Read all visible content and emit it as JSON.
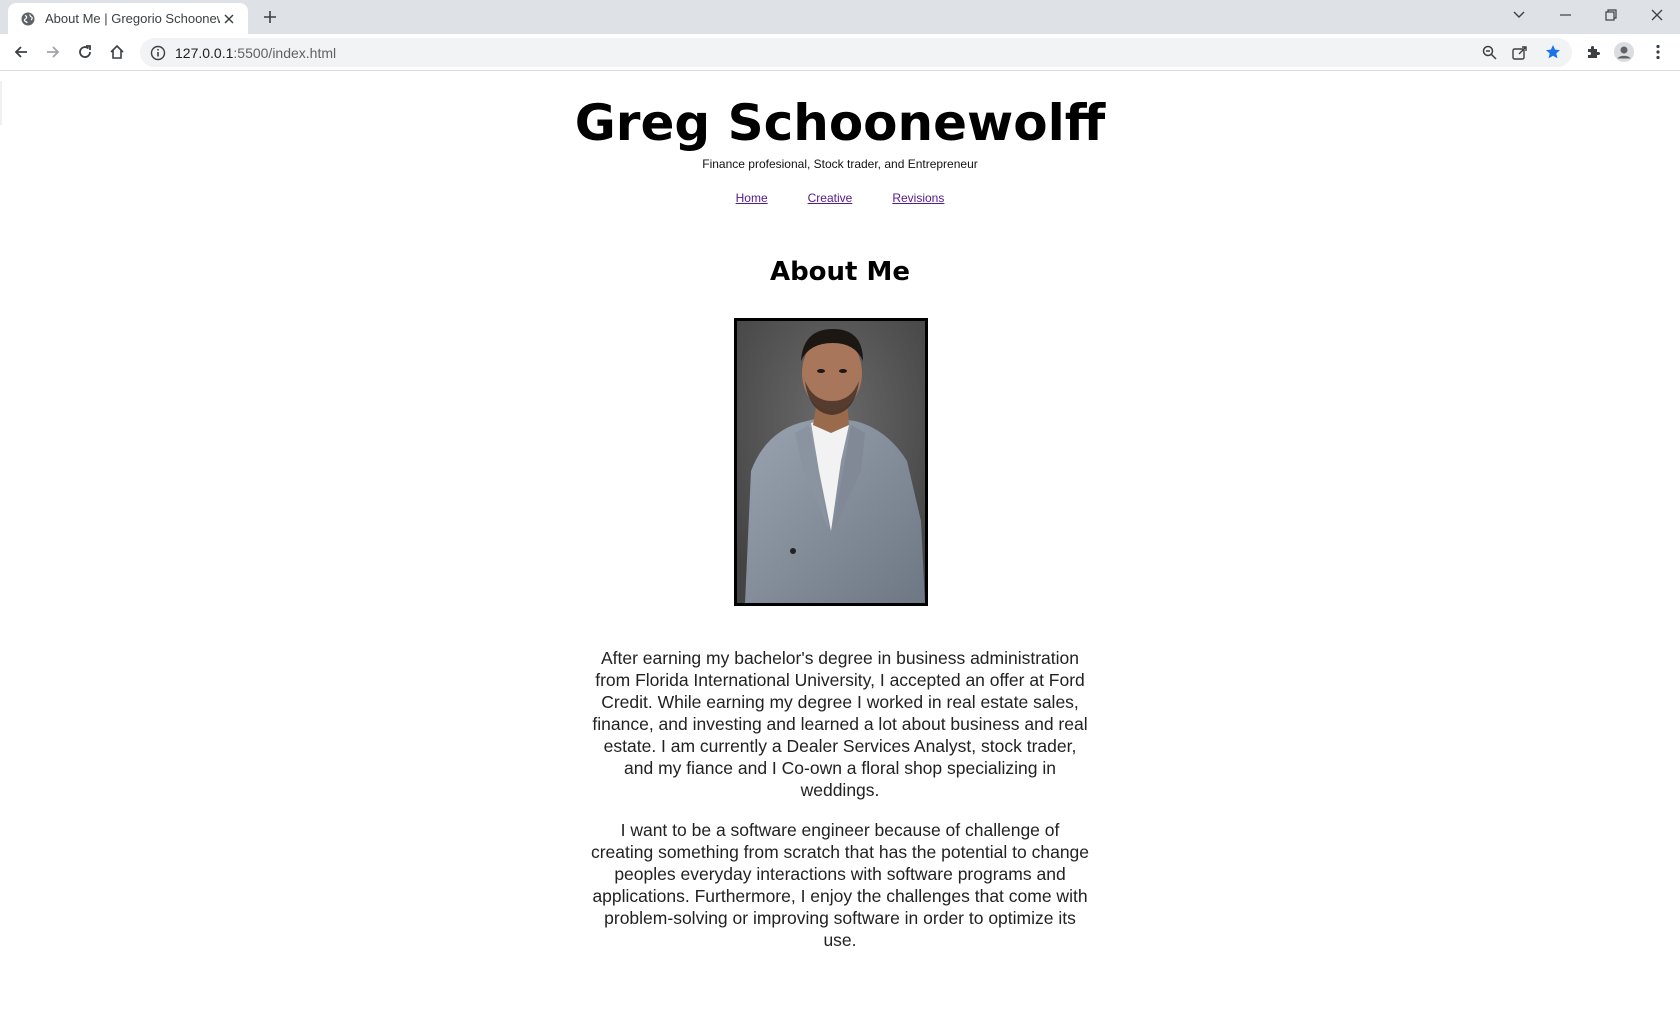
{
  "browser": {
    "tab_title": "About Me | Gregorio Schoonewolff",
    "url_host": "127.0.0.1",
    "url_path": ":5500/index.html",
    "accent_color": "#1a73e8"
  },
  "page": {
    "name": "Greg Schoonewolff",
    "tagline": "Finance profesional, Stock trader, and Entrepreneur",
    "nav": [
      "Home",
      "Creative",
      "Revisions"
    ],
    "heading": "About Me",
    "photo_alt": "portrait-photo",
    "paragraphs": [
      "After earning my bachelor's degree in business administration from Florida International University, I accepted an offer at Ford Credit. While earning my degree I worked in real estate sales, finance, and investing and learned a lot about business and real estate. I am currently a Dealer Services Analyst, stock trader, and my fiance and I Co-own a floral shop specializing in weddings.",
      "I want to be a software engineer because of challenge of creating something from scratch that has the potential to change peoples everyday interactions with software programs and applications. Furthermore, I enjoy the challenges that come with problem-solving or improving software in order to optimize its use."
    ]
  }
}
